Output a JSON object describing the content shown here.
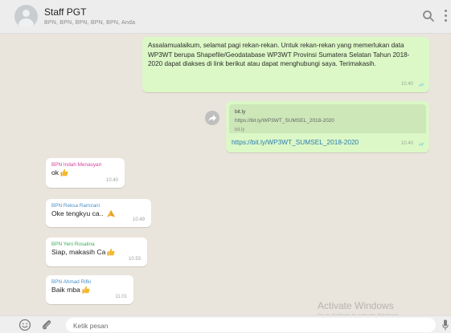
{
  "header": {
    "title": "Staff PGT",
    "members": "BPN, BPN, BPN, BPN, BPN, Anda",
    "icons": [
      "avatar",
      "search-icon",
      "menu-icon"
    ]
  },
  "messages": [
    {
      "kind": "outgoing",
      "text": "Assalamualaikum, selamat pagi rekan-rekan. Untuk rekan-rekan yang memerlukan data WP3WT berupa Shapefile/Geodatabase WP3WT Provinsi Sumatera Selatan Tahun 2018-2020 dapat diakses di link berikut atau dapat menghubungi saya. Terimakasih.",
      "time": "10.40"
    },
    {
      "kind": "outgoing-preview",
      "preview_title": "bit.ly",
      "preview_url": "https://bit.ly/WP3WT_SUMSEL_2018-2020",
      "preview_host": "bit.ly"
    },
    {
      "kind": "outgoing",
      "text": "https://bit.ly/WP3WT_SUMSEL_2018-2020",
      "time": "10.40"
    },
    {
      "kind": "incoming",
      "sender": "BPN Indah Menasyari",
      "text": "ok",
      "emoji": "thumbs-up",
      "time": "10.40",
      "sender_color": "#d6409f"
    },
    {
      "kind": "incoming",
      "sender": "BPN Reksa Ramzani",
      "text": "Oke tengkyu ca..",
      "emoji": "folded-hands",
      "time": "10.49",
      "sender_color": "#4a90c8"
    },
    {
      "kind": "incoming",
      "sender": "BPN Yeni Rosalina",
      "text": "Siap, makasih Ca",
      "emoji": "thumbs-up",
      "time": "10.53",
      "sender_color": "#3fae5a"
    },
    {
      "kind": "incoming",
      "sender": "BPN Ahmad Rifki",
      "text": "Baik mba",
      "emoji": "thumbs-up",
      "time": "11.01",
      "sender_color": "#4a90c8"
    }
  ],
  "watermark": {
    "line1": "Activate Windows",
    "line2": "Go to Settings to activate Windows."
  },
  "footer": {
    "placeholder": "Ketik pesan",
    "icons": [
      "emoji-icon",
      "attach-icon",
      "mic-icon"
    ]
  },
  "colors": {
    "outgoing_bubble": "#dcf8c6",
    "incoming_bubble": "#ffffff",
    "chat_background": "#e9e4dc",
    "link": "#2a7bb4",
    "read_check": "#4fc3f7"
  }
}
